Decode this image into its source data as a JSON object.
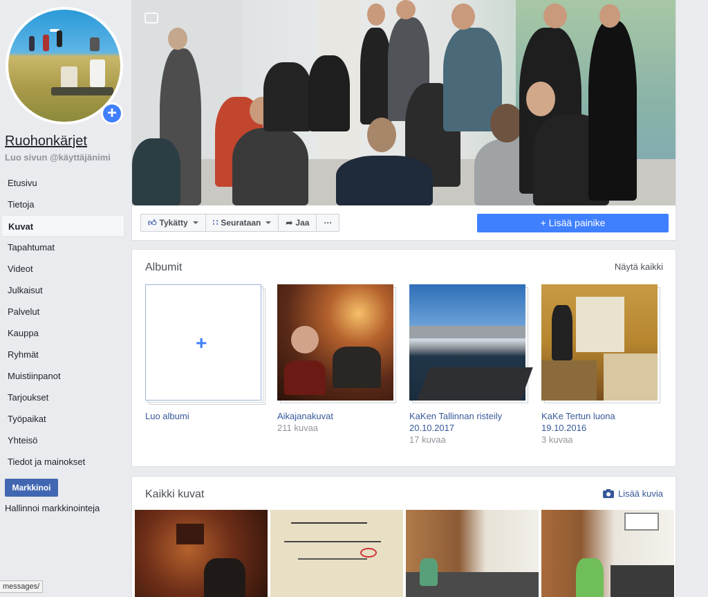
{
  "page": {
    "name": "Ruohonkärjet",
    "username_prompt": "Luo sivun @käyttäjänimi"
  },
  "nav": {
    "items": [
      {
        "label": "Etusivu"
      },
      {
        "label": "Tietoja"
      },
      {
        "label": "Kuvat",
        "active": true
      },
      {
        "label": "Tapahtumat"
      },
      {
        "label": "Videot"
      },
      {
        "label": "Julkaisut"
      },
      {
        "label": "Palvelut"
      },
      {
        "label": "Kauppa"
      },
      {
        "label": "Ryhmät"
      },
      {
        "label": "Muistiinpanot"
      },
      {
        "label": "Tarjoukset"
      },
      {
        "label": "Työpaikat"
      },
      {
        "label": "Yhteisö"
      },
      {
        "label": "Tiedot ja mainokset"
      }
    ],
    "promote_label": "Markkinoi",
    "manage_label": "Hallinnoi markkinointeja"
  },
  "actions": {
    "like": "Tykätty",
    "follow": "Seurataan",
    "share": "Jaa",
    "more": "···",
    "add_button": "Lisää painike"
  },
  "albums": {
    "title": "Albumit",
    "see_all": "Näytä kaikki",
    "create_label": "Luo albumi",
    "list": [
      {
        "name": "Aikajanakuvat",
        "count": "211 kuvaa"
      },
      {
        "name": "KaKen Tallinnan risteily 20.10.2017",
        "count": "17 kuvaa"
      },
      {
        "name": "KaKe Tertun luona 19.10.2016",
        "count": "3 kuvaa"
      }
    ]
  },
  "photos": {
    "title": "Kaikki kuvat",
    "add_label": "Lisää kuvia"
  },
  "status": {
    "tooltip": "messages/"
  },
  "colors": {
    "accent": "#4080ff",
    "link": "#365899",
    "promote": "#4267b2",
    "background": "#e9ebee"
  },
  "icons": [
    "plus-icon",
    "thumbs-up-icon",
    "rss-icon",
    "share-arrow-icon",
    "camera-icon",
    "caret-down-icon"
  ]
}
